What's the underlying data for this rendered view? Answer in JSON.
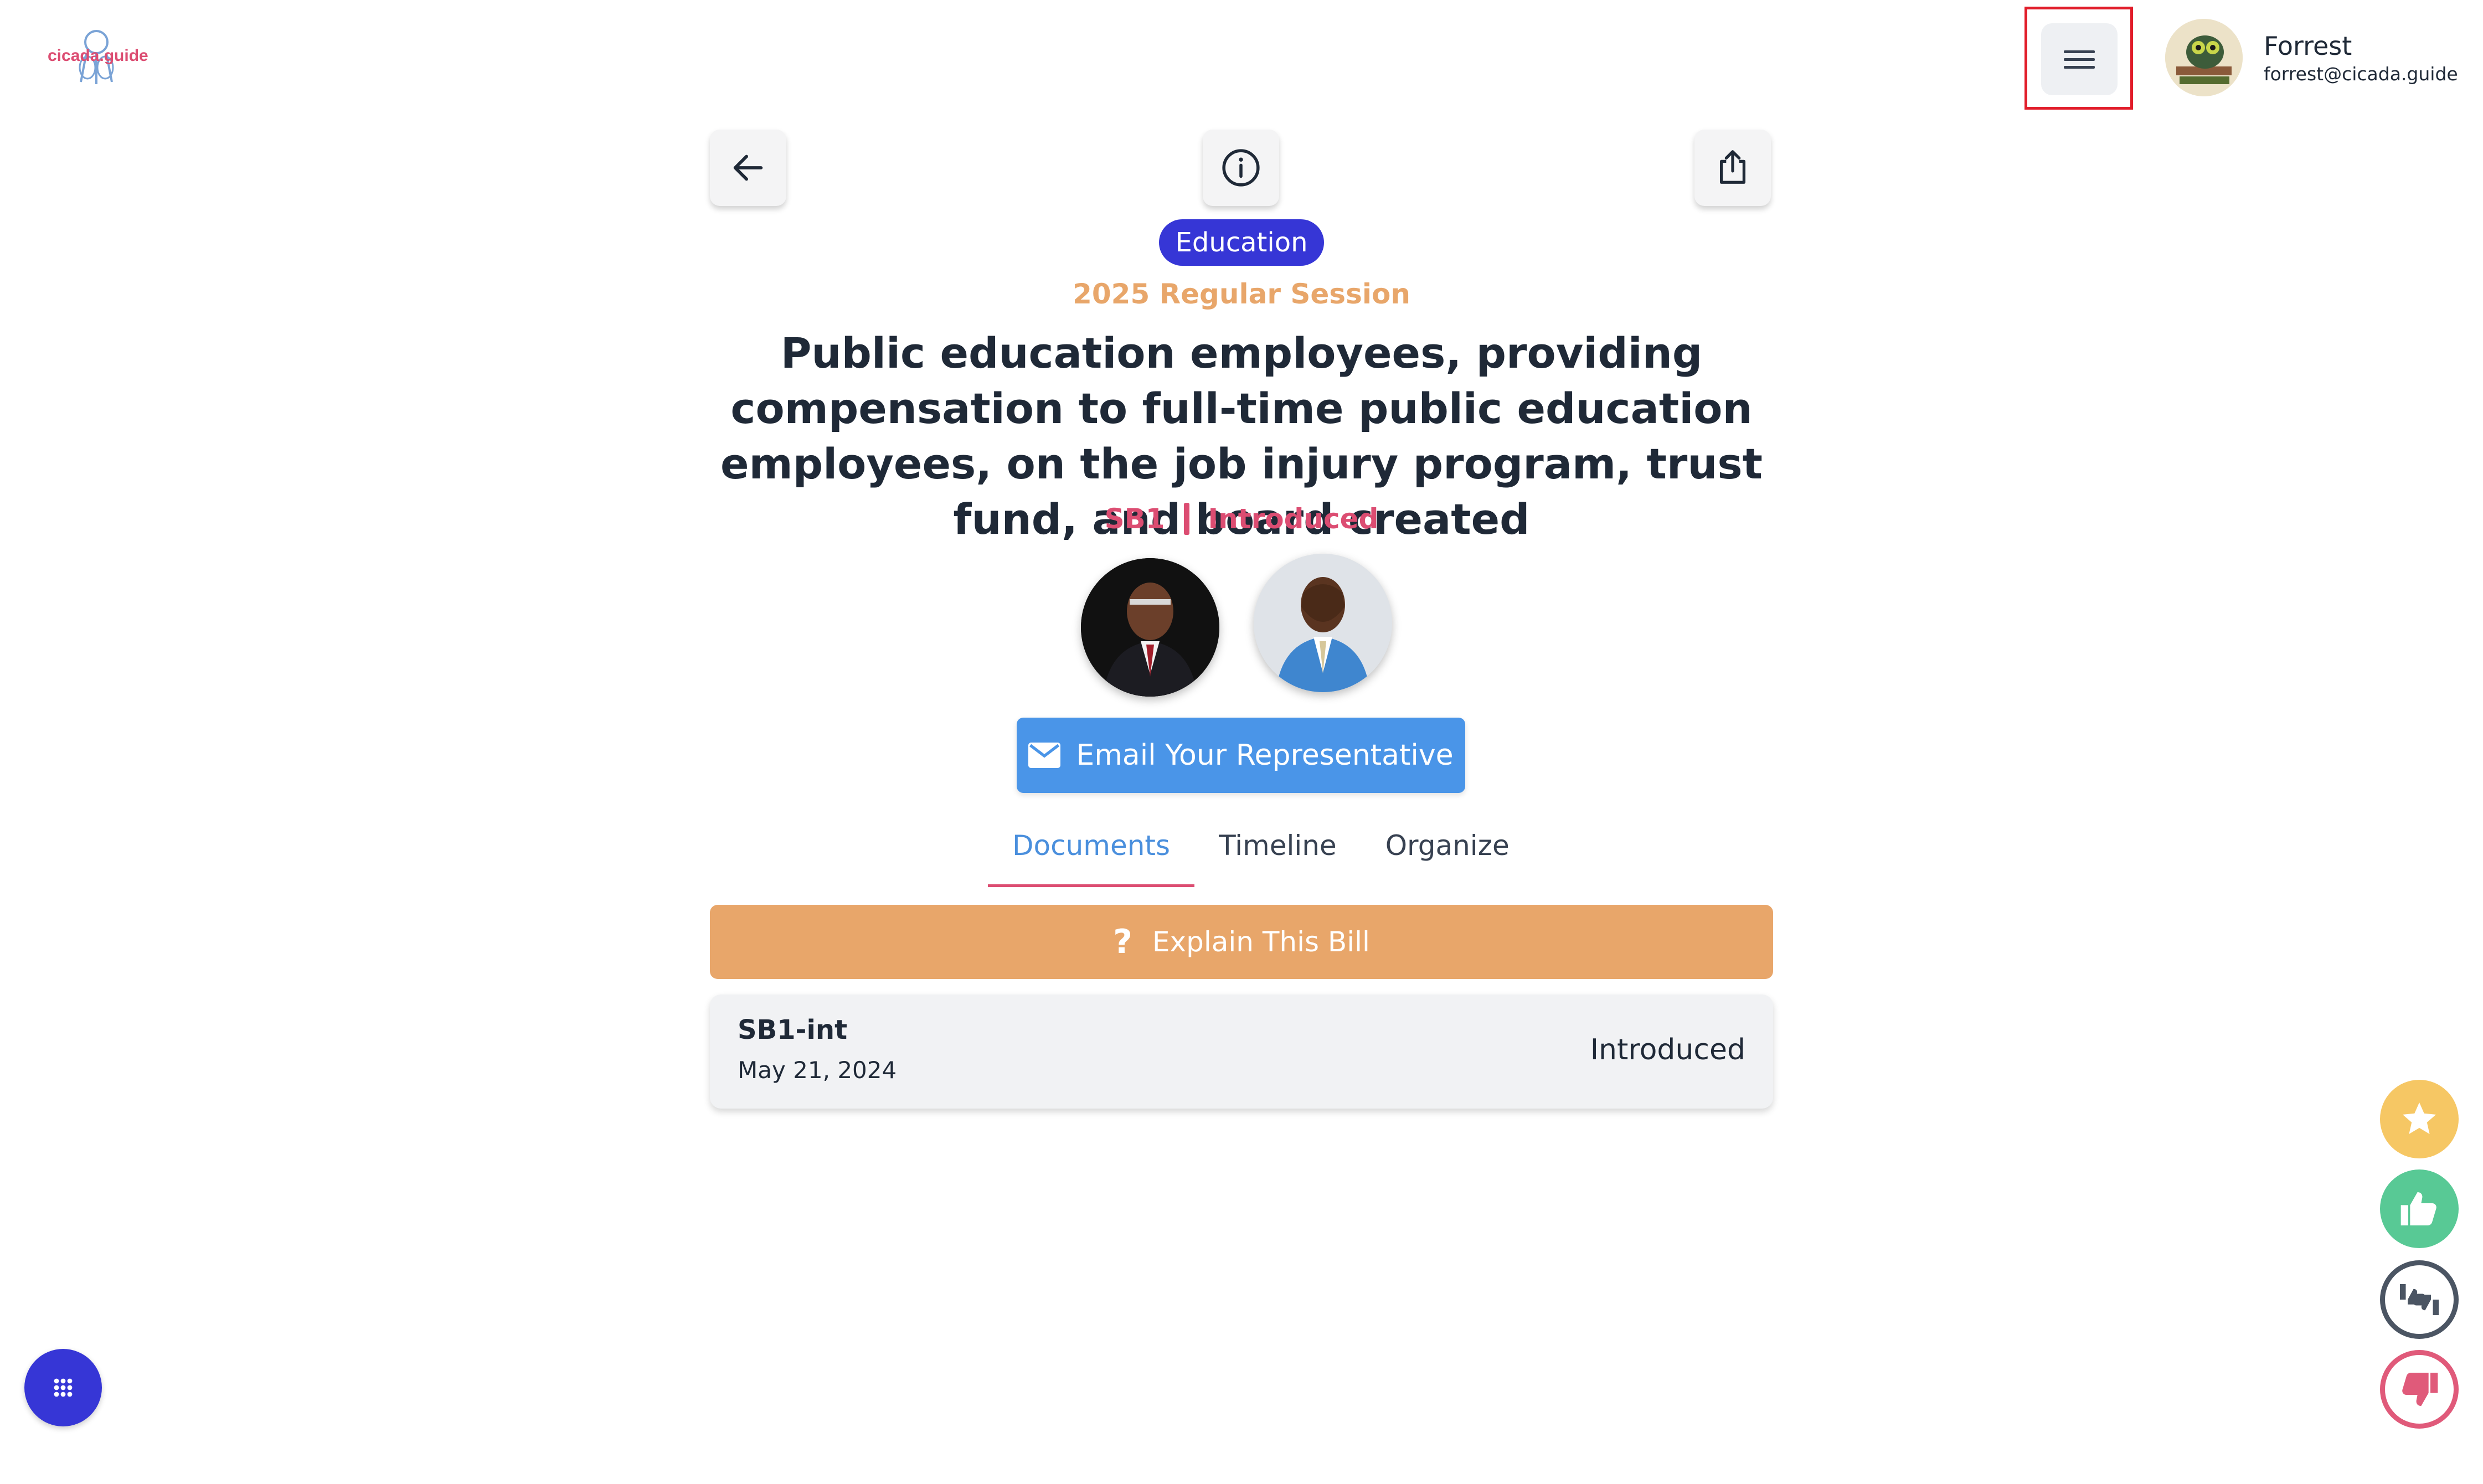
{
  "header": {
    "logo_text": "cicada.guide",
    "menu_icon": "hamburger-menu-icon",
    "user": {
      "name": "Forrest",
      "email": "forrest@cicada.guide"
    }
  },
  "actions": {
    "back_icon": "arrow-left-icon",
    "info_icon": "info-icon",
    "share_icon": "share-icon"
  },
  "bill": {
    "category": "Education",
    "session": "2025 Regular Session",
    "title": "Public education employees, providing compensation to full-time public education employees, on the job injury program, trust fund, and board created",
    "number": "SB1",
    "status": "Introduced"
  },
  "email_button": {
    "label": "Email Your Representative",
    "icon": "mail-icon"
  },
  "tabs": [
    {
      "label": "Documents",
      "active": true
    },
    {
      "label": "Timeline",
      "active": false
    },
    {
      "label": "Organize",
      "active": false
    }
  ],
  "explain": {
    "label": "Explain This Bill",
    "icon": "question-icon"
  },
  "documents": [
    {
      "name": "SB1-int",
      "date": "May 21, 2024",
      "status": "Introduced"
    }
  ],
  "reactions": [
    "star-icon",
    "thumbs-up-icon",
    "thumbs-mixed-icon",
    "thumbs-down-icon"
  ],
  "colors": {
    "brand": "#3636d6",
    "accent_orange": "#e8a66a",
    "accent_pink": "#dc4d72",
    "email_blue": "#4a95e8",
    "highlight": "#e11d2a"
  }
}
